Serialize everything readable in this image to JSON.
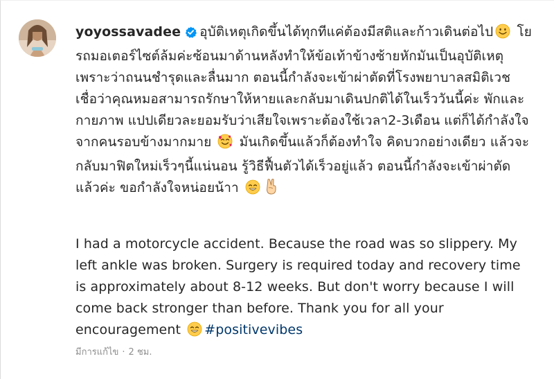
{
  "post": {
    "username": "yoyossavadee",
    "thai_caption_1": "อุบัติเหตุเกิดขึ้นได้ทุกทีแค่ต้องมีสติและก้าวเดินต่อไป",
    "thai_caption_2": "โยรถมอเตอร์ไซต์ล้มค่ะซ้อนมาด้านหลังทำให้ข้อเท้าข้างซ้ายหักมันเป็นอุบัติเหตุเพราะว่าถนนชำรุดและลื่นมาก ตอนนี้กำลังจะเข้าผ่าตัดที่โรงพยาบาลสมิติเวช เชื่อว่าคุณหมอสามารถรักษาให้หายและกลับมาเดินปกติได้ในเร็ววันนี้ค่ะ พักและกายภาพ แปปเดียวละยอมรับว่าเสียใจเพราะต้องใช้เวลา2-3เดือน แต่ก็ได้กำลังใจจากคนรอบข้างมากมาย",
    "thai_caption_3": "มันเกิดขึ้นแล้วก็ต้องทำใจ คิดบวกอย่างเดียว แล้วจะกลับมาฟิตใหม่เร็วๆนี้แน่นอน รู้วิธีฟื้นตัวได้เร็วอยู่แล้ว ตอนนี้กำลังจะเข้าผ่าตัดแล้วค่ะ ขอกำลังใจหน่อยน้าา",
    "english_caption": "I had a motorcycle accident. Because the road was so slippery. My left ankle was broken. Surgery is required today and recovery time is approximately about 8-12 weeks. But don't worry because I will come back stronger than before. Thank you for all your encouragement",
    "hashtag": "#positivevibes",
    "edited_label": "มีการแก้ไข",
    "separator": "·",
    "time_ago": "2 ชม."
  },
  "icons": {
    "verified": "verified-badge-icon",
    "smile": "smiling-face-emoji",
    "hearts": "smiling-face-with-hearts-emoji",
    "grin": "grinning-face-emoji",
    "victory": "victory-hand-emoji"
  },
  "colors": {
    "text": "#262626",
    "hashtag": "#00376b",
    "meta": "#8e8e8e",
    "verified": "#0095f6",
    "emoji_yellow": "#ffcc4d"
  }
}
